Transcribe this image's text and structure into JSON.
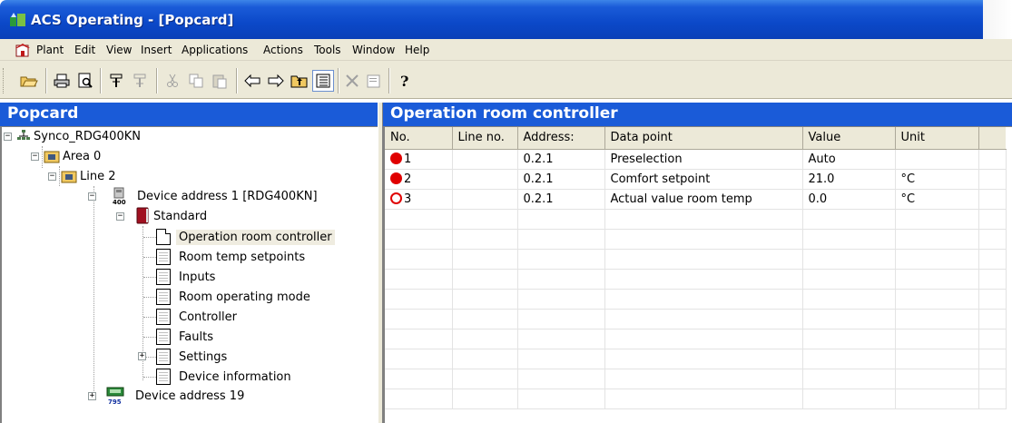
{
  "window": {
    "title": "ACS Operating - [Popcard]"
  },
  "menu": {
    "items": [
      "Plant",
      "Edit",
      "View",
      "Insert",
      "Applications",
      "Actions",
      "Tools",
      "Window",
      "Help"
    ]
  },
  "toolbar": {
    "buttons": [
      "open-folder-icon",
      "print-icon",
      "print-preview-icon",
      "connect-icon",
      "disconnect-icon",
      "cut-icon",
      "copy-icon",
      "paste-icon",
      "back-arrow-icon",
      "forward-arrow-icon",
      "up-folder-icon",
      "view-list-icon",
      "delete-icon",
      "properties-icon",
      "help-icon"
    ]
  },
  "left_pane": {
    "title": "Popcard",
    "tree": {
      "root": "Synco_RDG400KN",
      "area": "Area 0",
      "line": "Line 2",
      "device1": "Device address 1 [RDG400KN]",
      "standard": "Standard",
      "pages": [
        "Operation room controller",
        "Room temp setpoints",
        "Inputs",
        "Room operating mode",
        "Controller",
        "Faults",
        "Settings",
        "Device information"
      ],
      "device19": "Device address 19"
    }
  },
  "right_pane": {
    "title": "Operation room controller",
    "columns": [
      "No.",
      "Line no.",
      "Address:",
      "Data point",
      "Value",
      "Unit"
    ],
    "rows": [
      {
        "no": "1",
        "line_no": "",
        "address": "0.2.1",
        "data_point": "Preselection",
        "value": "Auto",
        "unit": "",
        "status": "filled"
      },
      {
        "no": "2",
        "line_no": "",
        "address": "0.2.1",
        "data_point": "Comfort setpoint",
        "value": "21.0",
        "unit": "°C",
        "status": "filled"
      },
      {
        "no": "3",
        "line_no": "",
        "address": "0.2.1",
        "data_point": "Actual value room temp",
        "value": "0.0",
        "unit": "°C",
        "status": "empty"
      }
    ]
  },
  "colors": {
    "title_bar": "#0b48c8",
    "pane_header": "#1a5bd8",
    "status_red": "#e00000"
  }
}
